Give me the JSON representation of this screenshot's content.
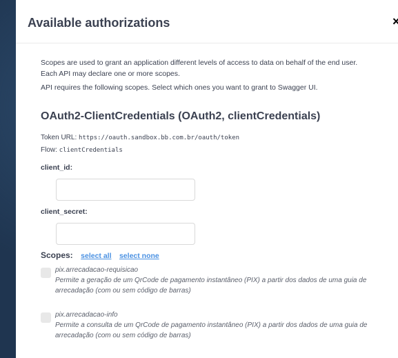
{
  "dialog": {
    "title": "Available authorizations",
    "close_symbol": "×"
  },
  "intro": {
    "line1": "Scopes are used to grant an application different levels of access to data on behalf of the end user.",
    "line2": "Each API may declare one or more scopes.",
    "line3": "API requires the following scopes. Select which ones you want to grant to Swagger UI."
  },
  "scheme": {
    "title": "OAuth2-ClientCredentials (OAuth2, clientCredentials)",
    "token_url_label": "Token URL:",
    "token_url": "https://oauth.sandbox.bb.com.br/oauth/token",
    "flow_label": "Flow:",
    "flow": "clientCredentials"
  },
  "fields": {
    "client_id_label": "client_id:",
    "client_id_value": "",
    "client_secret_label": "client_secret:",
    "client_secret_value": ""
  },
  "scopes": {
    "label": "Scopes:",
    "select_all": "select all",
    "select_none": "select none",
    "items": [
      {
        "name": "pix.arrecadacao-requisicao",
        "description": "Permite a geração de um QrCode de pagamento instantâneo (PIX) a partir dos dados de uma guia de arrecadação (com ou sem código de barras)",
        "checked": false
      },
      {
        "name": "pix.arrecadacao-info",
        "description": "Permite a consulta de um QrCode de pagamento instantâneo (PIX) a partir dos dados de uma guia de arrecadação (com ou sem código de barras)",
        "checked": false
      }
    ]
  }
}
